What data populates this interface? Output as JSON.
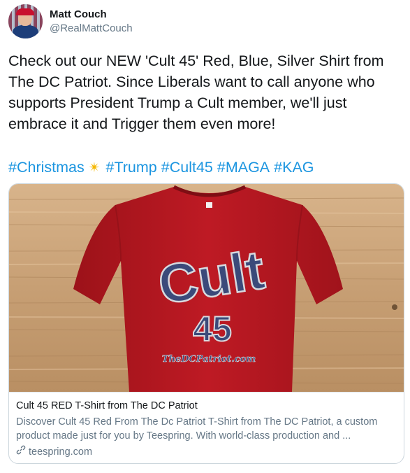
{
  "author": {
    "display_name": "Matt Couch",
    "handle": "@RealMattCouch"
  },
  "tweet": {
    "lines": [
      "Check out our NEW 'Cult 45' Red, Blue, Silver Shirt from",
      "The DC Patriot. Since Liberals want to call anyone who",
      "supports President Trump a Cult member, we'll just",
      "embrace it and Trigger them even more!"
    ],
    "hashtags": [
      "#Christmas",
      "#Trump",
      "#Cult45",
      "#MAGA",
      "#KAG"
    ],
    "sparkle_icon": "✴"
  },
  "card": {
    "shirt_text_main": "Cult",
    "shirt_text_number": "45",
    "shirt_text_site": "TheDCPatriot.com",
    "title": "Cult 45 RED T-Shirt from The DC Patriot",
    "description": "Discover Cult 45 Red From The Dc Patriot T-Shirt from The DC Patriot, a custom product made just for you by Teespring. With world-class production and ...",
    "domain": "teespring.com",
    "link_icon": "link-icon"
  },
  "colors": {
    "hashtag": "#1b95e0",
    "shirt_red": "#b3161f",
    "print_navy": "#3b4a7a",
    "wood": "#c9a47e"
  }
}
